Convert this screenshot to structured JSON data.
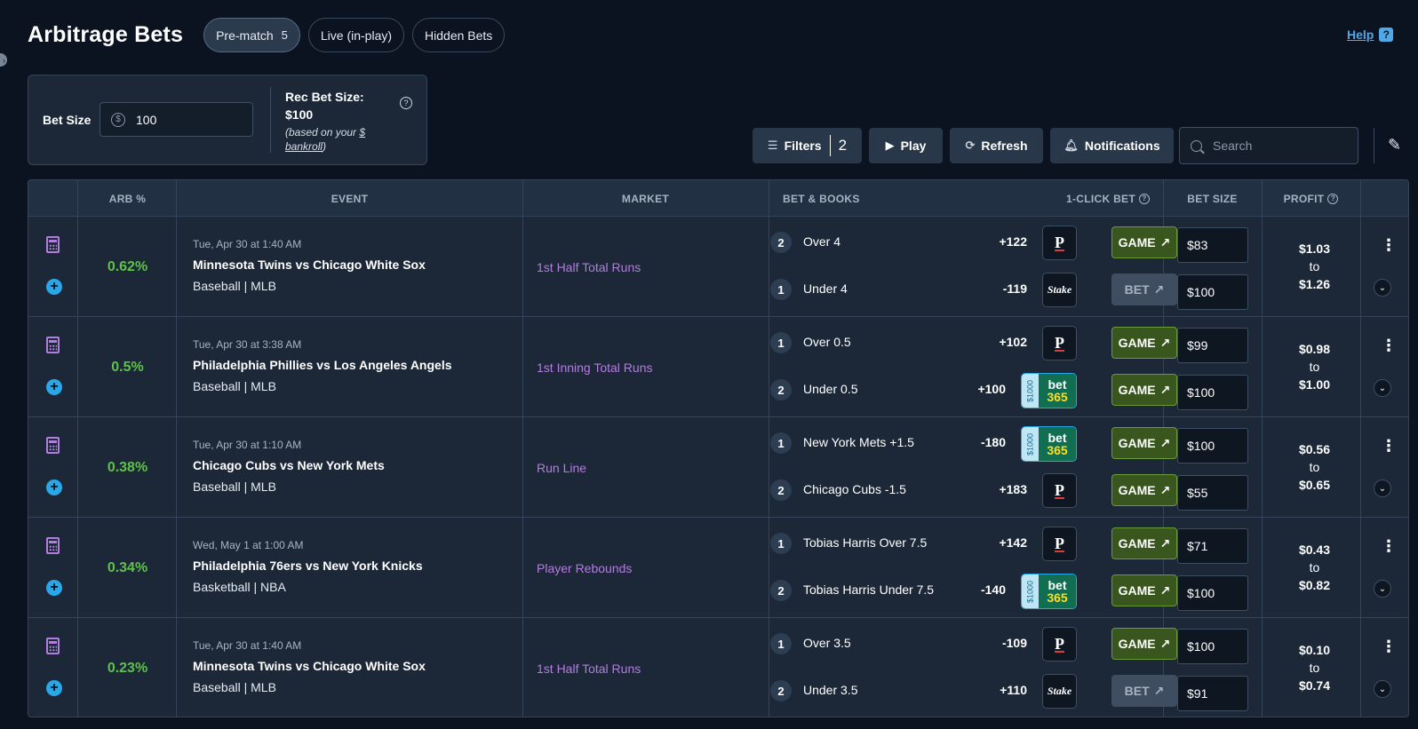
{
  "header": {
    "title": "Arbitrage Bets",
    "tabs": [
      {
        "label": "Pre-match",
        "count": "5"
      },
      {
        "label": "Live (in-play)"
      },
      {
        "label": "Hidden Bets"
      }
    ],
    "help_label": "Help"
  },
  "bet_panel": {
    "label": "Bet Size",
    "value": "100",
    "rec_title": "Rec Bet Size:",
    "rec_value": "$100",
    "based_prefix": "(based on your",
    "based_link1": "$",
    "based_link2": "bankroll",
    "based_suffix": ")"
  },
  "toolbar": {
    "filters_label": "Filters",
    "filters_count": "2",
    "play_label": "Play",
    "refresh_label": "Refresh",
    "notifications_label": "Notifications",
    "search_placeholder": "Search"
  },
  "table": {
    "columns": {
      "arb": "ARB %",
      "event": "EVENT",
      "market": "MARKET",
      "bet_books": "BET & BOOKS",
      "one_click": "1-CLICK BET",
      "bet_size": "BET SIZE",
      "profit": "PROFIT"
    },
    "rows": [
      {
        "arb": "0.62%",
        "date": "Tue, Apr 30 at 1:40 AM",
        "event": "Minnesota Twins vs Chicago White Sox",
        "sport": "Baseball | MLB",
        "market": "1st Half Total Runs",
        "legs": [
          {
            "num": "2",
            "selection": "Over 4",
            "odds": "+122",
            "book": "prizepicks",
            "action": "GAME",
            "size": "$83"
          },
          {
            "num": "1",
            "selection": "Under 4",
            "odds": "-119",
            "book": "stake",
            "action": "BET",
            "size": "$100"
          }
        ],
        "profit_low": "$1.03",
        "profit_to": "to",
        "profit_high": "$1.26"
      },
      {
        "arb": "0.5%",
        "date": "Tue, Apr 30 at 3:38 AM",
        "event": "Philadelphia Phillies vs Los Angeles Angels",
        "sport": "Baseball | MLB",
        "market": "1st Inning Total Runs",
        "legs": [
          {
            "num": "1",
            "selection": "Over 0.5",
            "odds": "+102",
            "book": "prizepicks",
            "action": "GAME",
            "size": "$99"
          },
          {
            "num": "2",
            "selection": "Under 0.5",
            "odds": "+100",
            "book": "bet365",
            "action": "GAME",
            "size": "$100"
          }
        ],
        "profit_low": "$0.98",
        "profit_to": "to",
        "profit_high": "$1.00"
      },
      {
        "arb": "0.38%",
        "date": "Tue, Apr 30 at 1:10 AM",
        "event": "Chicago Cubs vs New York Mets",
        "sport": "Baseball | MLB",
        "market": "Run Line",
        "legs": [
          {
            "num": "1",
            "selection": "New York Mets +1.5",
            "odds": "-180",
            "book": "bet365",
            "action": "GAME",
            "size": "$100"
          },
          {
            "num": "2",
            "selection": "Chicago Cubs -1.5",
            "odds": "+183",
            "book": "prizepicks",
            "action": "GAME",
            "size": "$55"
          }
        ],
        "profit_low": "$0.56",
        "profit_to": "to",
        "profit_high": "$0.65"
      },
      {
        "arb": "0.34%",
        "date": "Wed, May 1 at 1:00 AM",
        "event": "Philadelphia 76ers vs New York Knicks",
        "sport": "Basketball | NBA",
        "market": "Player Rebounds",
        "legs": [
          {
            "num": "1",
            "selection": "Tobias Harris Over 7.5",
            "odds": "+142",
            "book": "prizepicks",
            "action": "GAME",
            "size": "$71"
          },
          {
            "num": "2",
            "selection": "Tobias Harris Under 7.5",
            "odds": "-140",
            "book": "bet365",
            "action": "GAME",
            "size": "$100"
          }
        ],
        "profit_low": "$0.43",
        "profit_to": "to",
        "profit_high": "$0.82"
      },
      {
        "arb": "0.23%",
        "date": "Tue, Apr 30 at 1:40 AM",
        "event": "Minnesota Twins vs Chicago White Sox",
        "sport": "Baseball | MLB",
        "market": "1st Half Total Runs",
        "legs": [
          {
            "num": "1",
            "selection": "Over 3.5",
            "odds": "-109",
            "book": "prizepicks",
            "action": "GAME",
            "size": "$100"
          },
          {
            "num": "2",
            "selection": "Under 3.5",
            "odds": "+110",
            "book": "stake",
            "action": "BET",
            "size": "$91"
          }
        ],
        "profit_low": "$0.10",
        "profit_to": "to",
        "profit_high": "$0.74"
      }
    ]
  },
  "books": {
    "prizepicks_glyph": "P",
    "stake_label": "Stake",
    "bet365_bonus": "$1000",
    "bet365_top": "bet",
    "bet365_bottom": "365"
  },
  "icons": {
    "calculator": "calculator-icon",
    "plus": "plus-circle-icon",
    "arrow": "arrow-up-right-icon",
    "kebab": "kebab-menu-icon",
    "chevron": "chevron-down-icon"
  },
  "colors": {
    "accent_green": "#5ec24a",
    "market_purple": "#b37ce0",
    "link_blue": "#4fa8e8"
  }
}
